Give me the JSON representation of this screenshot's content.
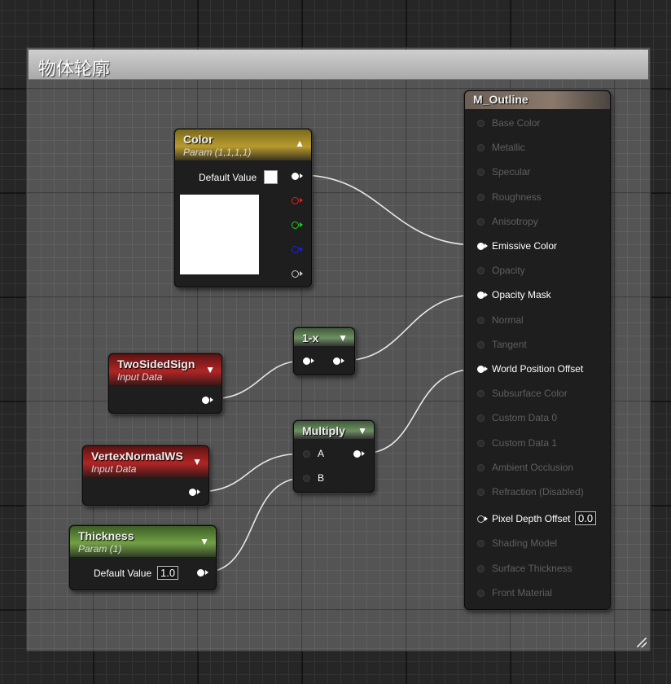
{
  "comment": {
    "title": "物体轮廓"
  },
  "nodes": {
    "color": {
      "title": "Color",
      "subtitle": "Param (1,1,1,1)",
      "default_label": "Default Value"
    },
    "one_minus": {
      "title": "1-x"
    },
    "two_sided": {
      "title": "TwoSidedSign",
      "subtitle": "Input Data"
    },
    "multiply": {
      "title": "Multiply",
      "pin_a": "A",
      "pin_b": "B"
    },
    "vertex_normal": {
      "title": "VertexNormalWS",
      "subtitle": "Input Data"
    },
    "thickness": {
      "title": "Thickness",
      "subtitle": "Param (1)",
      "default_label": "Default Value",
      "default_value": "1.0"
    },
    "material": {
      "title": "M_Outline",
      "pins": [
        {
          "label": "Base Color",
          "active": false
        },
        {
          "label": "Metallic",
          "active": false
        },
        {
          "label": "Specular",
          "active": false
        },
        {
          "label": "Roughness",
          "active": false
        },
        {
          "label": "Anisotropy",
          "active": false
        },
        {
          "label": "Emissive Color",
          "active": true
        },
        {
          "label": "Opacity",
          "active": false
        },
        {
          "label": "Opacity Mask",
          "active": true
        },
        {
          "label": "Normal",
          "active": false
        },
        {
          "label": "Tangent",
          "active": false
        },
        {
          "label": "World Position Offset",
          "active": true
        },
        {
          "label": "Subsurface Color",
          "active": false
        },
        {
          "label": "Custom Data 0",
          "active": false
        },
        {
          "label": "Custom Data 1",
          "active": false
        },
        {
          "label": "Ambient Occlusion",
          "active": false
        },
        {
          "label": "Refraction (Disabled)",
          "active": false
        },
        {
          "label": "Pixel Depth Offset",
          "active": "unconnected",
          "value": "0.0"
        },
        {
          "label": "Shading Model",
          "active": false
        },
        {
          "label": "Surface Thickness",
          "active": false
        },
        {
          "label": "Front Material",
          "active": false
        }
      ]
    }
  },
  "colors": {
    "wire": "#e8e8e8",
    "accent_color_node": "#b89b2e",
    "accent_input_node": "#b12525",
    "accent_param_scalar": "#72a046"
  },
  "icons": {
    "collapse": "chevron-down-icon",
    "expand": "chevron-up-icon",
    "resize": "resize-grip-icon"
  }
}
